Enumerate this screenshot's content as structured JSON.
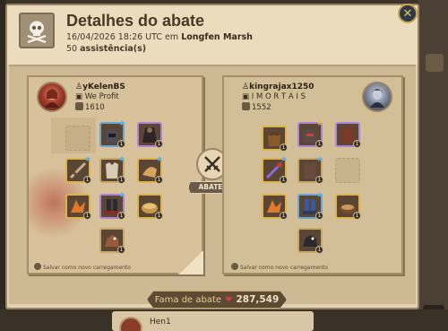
{
  "header": {
    "title": "Detalhes do abate",
    "date": "16/04/2026 18:26 UTC",
    "em": "em",
    "location": "Longfen Marsh",
    "assist_count": "50",
    "assist_label": "assistência(s)"
  },
  "killer": {
    "name": "yKelenBS",
    "guild": "We Profit",
    "ip": "1610",
    "save_label": "Salvar como novo carregamento"
  },
  "victim": {
    "name": "kingrajax1250",
    "guild": "I M O R T A I S",
    "ip": "1552",
    "save_label": "Salvar como novo carregamento"
  },
  "center": {
    "ribbon": "ABATEU"
  },
  "fame": {
    "label": "Fama de abate",
    "value": "287,549"
  },
  "background": {
    "next_name": "Hen1"
  },
  "colors": {
    "panel": "#e1d2b2",
    "accent_red": "#d73a3a",
    "gold": "#c6a35e",
    "title": "#4a3826"
  },
  "icons": {
    "header": "skull-crossbones-icon",
    "center": "crossed-swords-icon",
    "close": "close-icon",
    "fame": "fame-gem-icon"
  }
}
